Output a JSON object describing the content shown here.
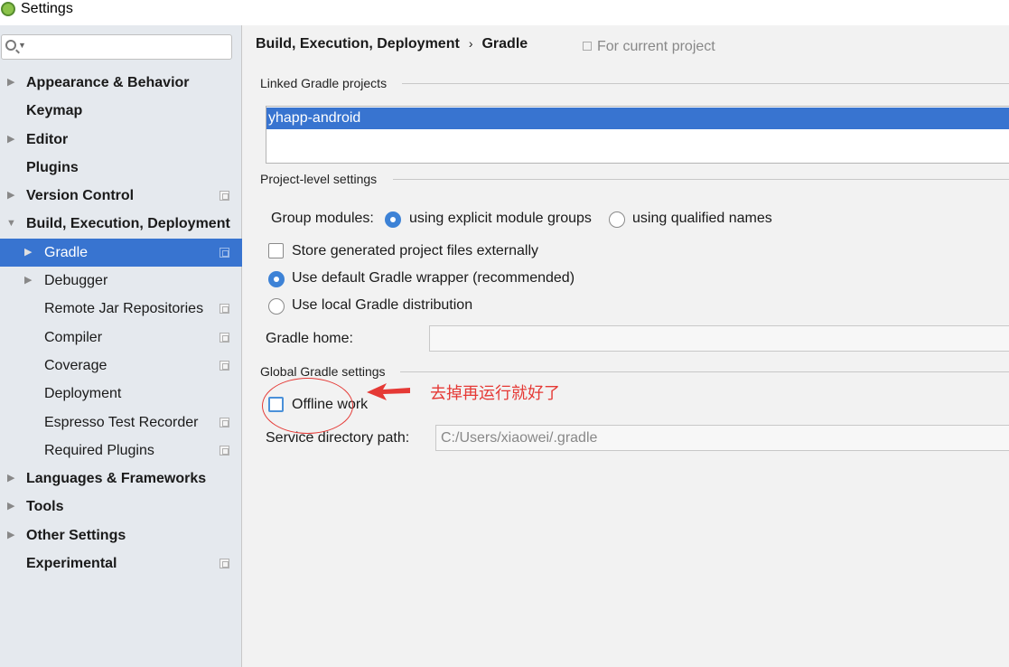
{
  "window": {
    "title": "Settings"
  },
  "search": {
    "placeholder": ""
  },
  "sidebar": {
    "items": [
      {
        "label": "Appearance & Behavior"
      },
      {
        "label": "Keymap"
      },
      {
        "label": "Editor"
      },
      {
        "label": "Plugins"
      },
      {
        "label": "Version Control"
      },
      {
        "label": "Build, Execution, Deployment"
      },
      {
        "label": "Gradle"
      },
      {
        "label": "Debugger"
      },
      {
        "label": "Remote Jar Repositories"
      },
      {
        "label": "Compiler"
      },
      {
        "label": "Coverage"
      },
      {
        "label": "Deployment"
      },
      {
        "label": "Espresso Test Recorder"
      },
      {
        "label": "Required Plugins"
      },
      {
        "label": "Languages & Frameworks"
      },
      {
        "label": "Tools"
      },
      {
        "label": "Other Settings"
      },
      {
        "label": "Experimental"
      }
    ]
  },
  "breadcrumb": {
    "parent": "Build, Execution, Deployment",
    "separator": "›",
    "current": "Gradle"
  },
  "scope": {
    "label": "For current project"
  },
  "linked": {
    "heading": "Linked Gradle projects",
    "projects": [
      "yhapp-android"
    ]
  },
  "project_level": {
    "heading": "Project-level settings",
    "group_modules_label": "Group modules:",
    "option_explicit": "using explicit module groups",
    "option_qualified": "using qualified names",
    "store_external_label": "Store generated project files externally",
    "default_wrapper_label": "Use default Gradle wrapper (recommended)",
    "local_distribution_label": "Use local Gradle distribution",
    "gradle_home_label": "Gradle home:",
    "gradle_home_value": ""
  },
  "global": {
    "heading": "Global Gradle settings",
    "offline_label": "Offline work",
    "service_dir_label": "Service directory path:",
    "service_dir_value": "C:/Users/xiaowei/.gradle"
  },
  "annotation": {
    "text": "去掉再运行就好了",
    "color": "#e53935"
  },
  "colors": {
    "selection": "#3874d0",
    "sidebar_bg": "#e5e9ee",
    "panel_bg": "#f2f2f2"
  }
}
